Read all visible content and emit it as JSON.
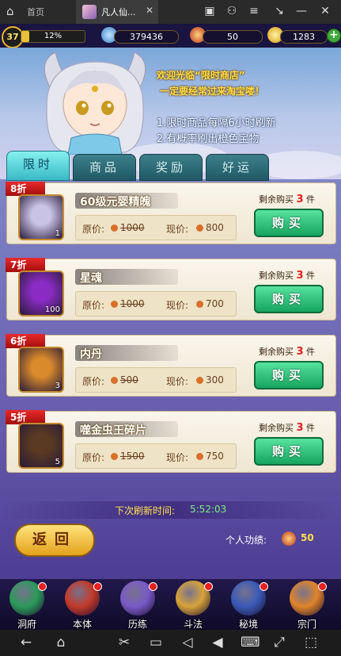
{
  "browser": {
    "tab1_label": "首页",
    "tab2_label": "凡人仙...",
    "close_glyph": "✕"
  },
  "status": {
    "level": "37",
    "xp_percent": "12%",
    "xp_fraction": 0.12,
    "spirit_stones": "379436",
    "tokens": "50",
    "gold": "1283",
    "plus": "+"
  },
  "header": {
    "welcome_line1": "欢迎光临“限时商店”",
    "welcome_line2": "一定要经常过来淘宝喽！",
    "rule1": "1.限时商品每隔6小时刷新",
    "rule2": "2.有概率刷出橙色宝物"
  },
  "tabs": [
    {
      "label": "限时",
      "active": true
    },
    {
      "label": "商品",
      "active": false
    },
    {
      "label": "奖励",
      "active": false
    },
    {
      "label": "好运",
      "active": false
    }
  ],
  "items": [
    {
      "discount": "8折",
      "name": "60级元婴精魄",
      "qty": "1",
      "orig_label": "原价:",
      "orig_price": "1000",
      "now_label": "现价:",
      "now_price": "800",
      "remain_label": "剩余购买",
      "remain": "3",
      "remain_unit": "件",
      "buy": "购买",
      "icon": "spirit-orb-icon",
      "color": "#c9c4e6"
    },
    {
      "discount": "7折",
      "name": "星魂",
      "qty": "100",
      "orig_label": "原价:",
      "orig_price": "1000",
      "now_label": "现价:",
      "now_price": "700",
      "remain_label": "剩余购买",
      "remain": "3",
      "remain_unit": "件",
      "buy": "购买",
      "icon": "star-soul-icon",
      "color": "#8a2cc4"
    },
    {
      "discount": "6折",
      "name": "内丹",
      "qty": "3",
      "orig_label": "原价:",
      "orig_price": "500",
      "now_label": "现价:",
      "now_price": "300",
      "remain_label": "剩余购买",
      "remain": "3",
      "remain_unit": "件",
      "buy": "购买",
      "icon": "inner-pill-icon",
      "color": "#d98a2a"
    },
    {
      "discount": "5折",
      "name": "噬金虫王碎片",
      "qty": "5",
      "orig_label": "原价:",
      "orig_price": "1500",
      "now_label": "现价:",
      "now_price": "750",
      "remain_label": "剩余购买",
      "remain": "3",
      "remain_unit": "件",
      "buy": "购买",
      "icon": "beetle-fragment-icon",
      "color": "#5a3a22"
    }
  ],
  "refresh": {
    "label": "下次刷新时间:",
    "time": "5:52:03"
  },
  "back_label": "返回",
  "merit": {
    "label": "个人功绩:",
    "value": "50"
  },
  "nav": [
    {
      "label": "洞府",
      "color": "#2b9a5a"
    },
    {
      "label": "本体",
      "color": "#c43a2a"
    },
    {
      "label": "历练",
      "color": "#7a5ac8"
    },
    {
      "label": "斗法",
      "color": "#d8a23a"
    },
    {
      "label": "秘境",
      "color": "#3a5ab8"
    },
    {
      "label": "宗门",
      "color": "#e0842a"
    }
  ]
}
